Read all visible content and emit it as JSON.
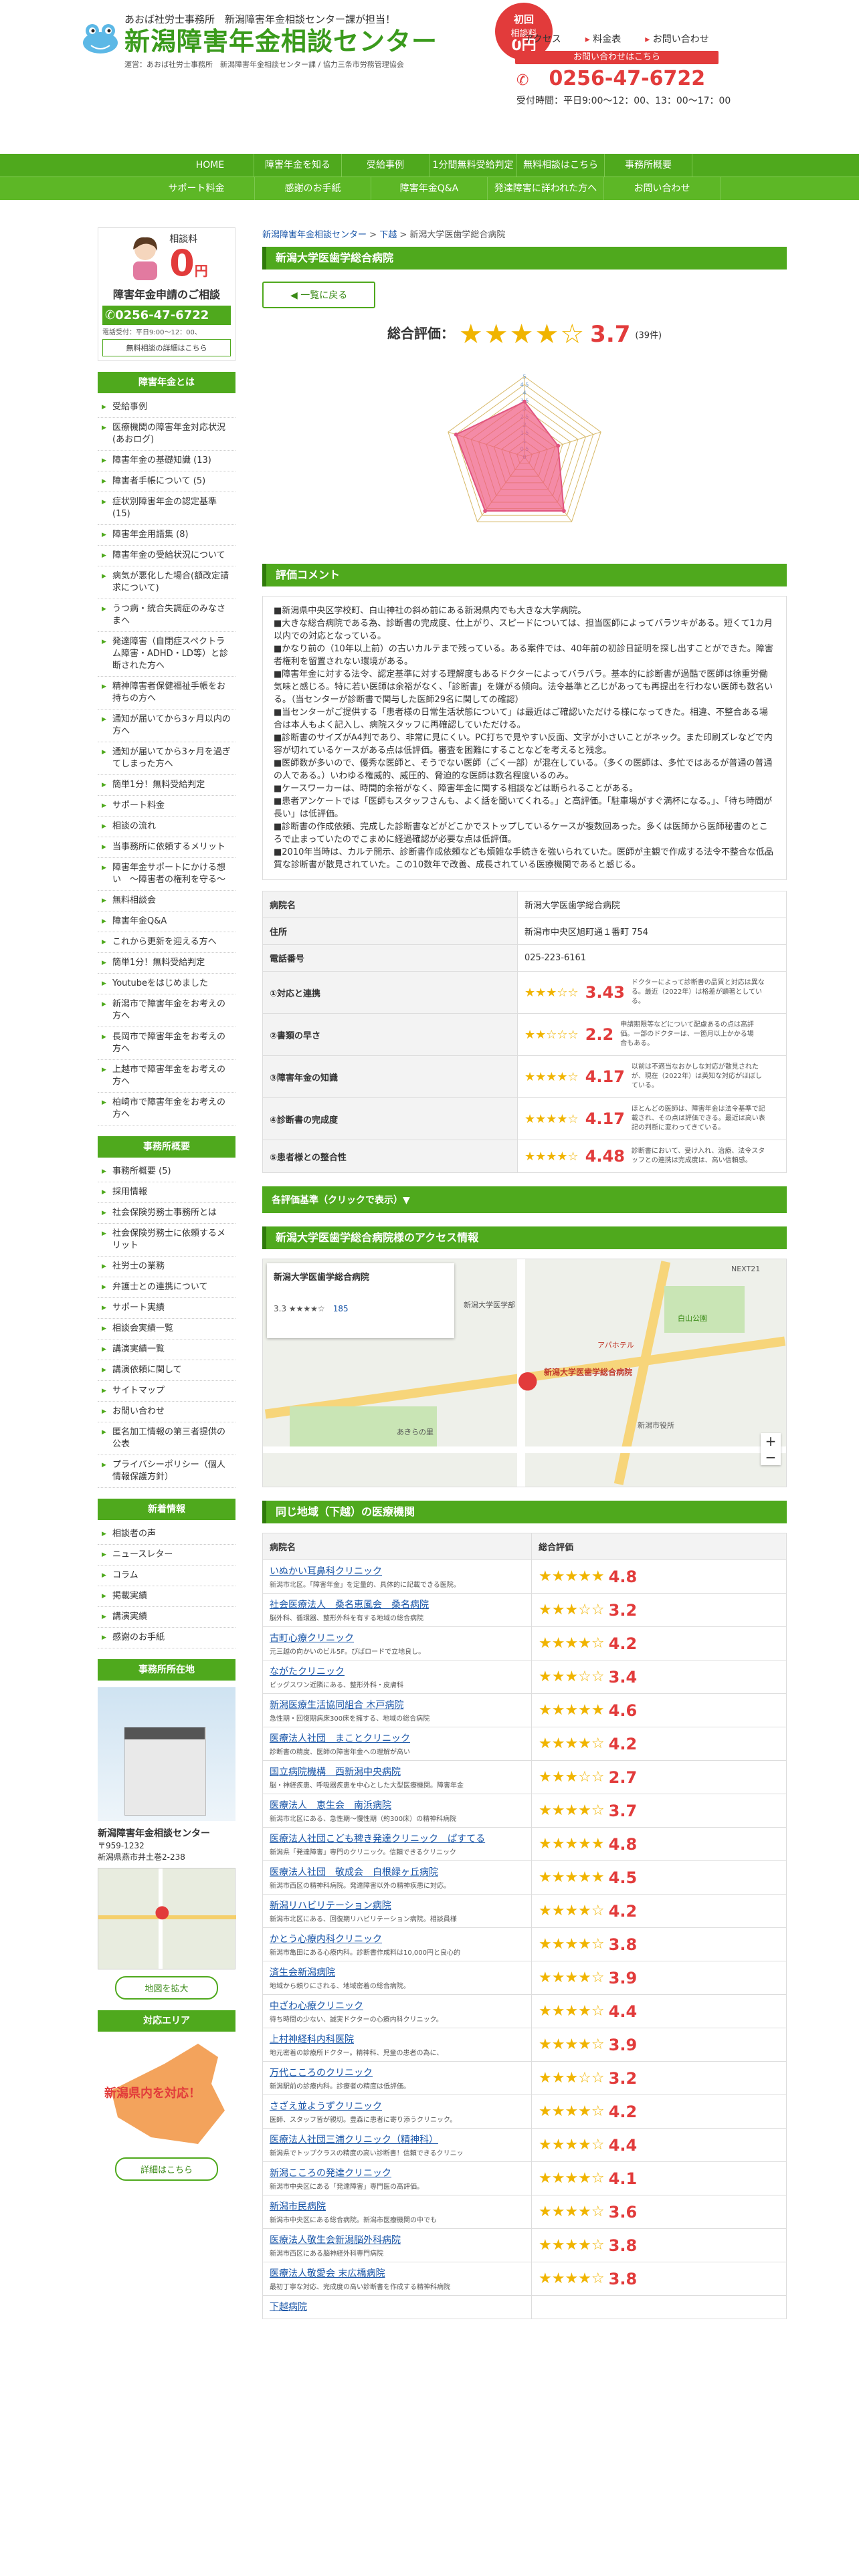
{
  "header": {
    "sub": "あおば社労士事務所　新潟障害年金相談センター課が担当！",
    "title": "新潟障害年金相談センター",
    "operator": "運営：あおば社労士事務所　新潟障害年金相談センター課 / 協力三条市労務管理協会",
    "badge_l1": "初回",
    "badge_l2": "相談料",
    "badge_l3": "0円",
    "links": [
      "アクセス",
      "料金表",
      "お問い合わせ"
    ],
    "cta": "お問い合わせはこちら",
    "phone": "0256-47-6722",
    "hours": "受付時間：平日9:00～12：00、13：00～17：00"
  },
  "nav": {
    "row1": [
      "HOME",
      "障害年金を知る",
      "受給事例",
      "1分間無料受給判定",
      "無料相談はこちら",
      "事務所概要"
    ],
    "row2": [
      "サポート料金",
      "感謝のお手紙",
      "障害年金Q&A",
      "発達障害に詳われた方へ",
      "お問い合わせ"
    ]
  },
  "breadcrumb": [
    "新潟障害年金相談センター",
    "下越",
    "新潟大学医歯学総合病院"
  ],
  "page_title": "新潟大学医歯学総合病院",
  "back_label": "一覧に戻る",
  "rating": {
    "label": "総合評価：",
    "value": "3.7",
    "count": "(39件)",
    "stars": "★★★★☆"
  },
  "chart_data": {
    "type": "radar",
    "axes": [
      "",
      "",
      "",
      "",
      ""
    ],
    "tick_labels": [
      "5",
      "4.5",
      "4",
      "3.5",
      "3",
      "2.5",
      "2",
      "1.5",
      "1",
      "0.5",
      "0"
    ],
    "values": [
      3.43,
      2.2,
      4.17,
      4.17,
      4.48
    ],
    "range": [
      0,
      5
    ]
  },
  "comment_title": "評価コメント",
  "comments": [
    "■新潟県中央区学校町、白山神社の斜め前にある新潟県内でも大きな大学病院。",
    "■大きな総合病院である為、診断書の完成度、仕上がり、スピードについては、担当医師によってバラツキがある。短くて1カ月以内での対応となっている。",
    "■かなり前の（10年以上前）の古いカルテまで残っている。ある案件では、40年前の初診日証明を探し出すことができた。障害者権利を留置されない環境がある。",
    "■障害年金に対する法令、認定基準に対する理解度もあるドクターによってバラバラ。基本的に診断書が過酷で医師は徐重労働気味と感じる。特に若い医師は余裕がなく、「診断書」を嫌がる傾向。法令基準と乙じがあっても再提出を行わない医師も数名いる。（当センターが診断書で関与した医師29名に関しての確認）",
    "■当センターがご提供する「患者様の日常生活状態について」は最近はご確認いただける様になってきた。相違、不整合ある場合は本人もよく記入し、病院スタッフに再確認していただける。",
    "■診断書のサイズがA4判であり、非常に見にくい。PC打ちで見やすい反面、文字が小さいことがネック。また印刷ズレなどで内容が切れているケースがある点は低評価。審査を困難にすることなどを考えると残念。",
    "■医師数が多いので、優秀な医師と、そうでない医師（ごく一部）が混在している。（多くの医師は、多忙ではあるが普通の普通の人である。）いわゆる権威的、威圧的、脅迫的な医師は数名程度いるのみ。",
    "■ケースワーカーは、時間的余裕がなく、障害年金に関する相談などは断られることがある。",
    "■患者アンケートでは「医師もスタッフさんも、よく話を聞いてくれる。」と高評価。「駐車場がすぐ満杯になる。」、「待ち時間が長い」は低評価。",
    "■診断書の作成依頼、完成した診断書などがどこかでストップしているケースが複数回あった。多くは医師から医師秘書のところで止まっていたのでこまめに経過確認が必要な点は低評価。",
    "■2010年当時は、カルテ開示、診断書作成依頼なども煩雑な手続きを強いられていた。医師が主観で作成する法令不整合な低品質な診断書が散見されていた。この10数年で改善、成長されている医療機関であると感じる。"
  ],
  "info": [
    {
      "k": "病院名",
      "v": "新潟大学医歯学総合病院"
    },
    {
      "k": "住所",
      "v": "新潟市中央区旭町通１番町 754"
    },
    {
      "k": "電話番号",
      "v": "025-223-6161"
    }
  ],
  "scores": [
    {
      "k": "①対応と連携",
      "v": "3.43",
      "stars": "★★★☆☆",
      "desc": "ドクターによって診断書の品質と対応は異なる。最近（2022年）は格差が顕著としている。"
    },
    {
      "k": "②書類の早さ",
      "v": "2.2",
      "stars": "★★☆☆☆",
      "desc": "申請期限等などについて配慮あるの点は高評価。一部のドクターは、一箇月以上かかる場合もある。"
    },
    {
      "k": "③障害年金の知識",
      "v": "4.17",
      "stars": "★★★★☆",
      "desc": "以前は不適当なおかしな対応が散見されたが、現在（2022年）は英知な対応がほぼしている。"
    },
    {
      "k": "④診断書の完成度",
      "v": "4.17",
      "stars": "★★★★☆",
      "desc": "ほとんどの医師は、障害年金は法令基準で記載され、その点は評価できる。最近は高い表記の判断に変わってきている。"
    },
    {
      "k": "⑤患者様との整合性",
      "v": "4.48",
      "stars": "★★★★☆",
      "desc": "診断書において、受け入れ、治療、法令スタッフとの連携は完成度は、高い信頼感。"
    }
  ],
  "criteria_label": "各評価基準（クリックで表示）▼",
  "access_title": "新潟大学医歯学総合病院様のアクセス情報",
  "map": {
    "place_label": "新潟大学医歯学総合病院",
    "labels": [
      "新潟大学医学部",
      "NEXT21",
      "白山公園",
      "新潟市役所",
      "アパホテル",
      "あきらの里"
    ],
    "rating_text": "3.3 ★★★★☆",
    "reviews": "185",
    "zoom_in": "+",
    "zoom_out": "−"
  },
  "area_title": "同じ地域（下越）の医療機関",
  "facility_headers": [
    "病院名",
    "総合評価"
  ],
  "facilities": [
    {
      "name": "いぬかい耳鼻科クリニック",
      "desc": "新潟市北区。「障害年金」を定量的、具体的に記載できる医院。",
      "v": "4.8",
      "stars": "★★★★★"
    },
    {
      "name": "社会医療法人　桑名恵風会　桑名病院",
      "desc": "脳外科、循環器、整形外科を有する地域の総合病院",
      "v": "3.2",
      "stars": "★★★☆☆"
    },
    {
      "name": "古町心療クリニック",
      "desc": "元三越の向かいのビル5F。びばロードで立地良し。",
      "v": "4.2",
      "stars": "★★★★☆"
    },
    {
      "name": "ながたクリニック",
      "desc": "ビッグスワン近隣にある、整形外科・皮膚科",
      "v": "3.4",
      "stars": "★★★☆☆"
    },
    {
      "name": "新潟医療生活協同組合 木戸病院",
      "desc": "急性期・回復期病床300床を擁する、地域の総合病院",
      "v": "4.6",
      "stars": "★★★★★"
    },
    {
      "name": "医療法人社団　まことクリニック",
      "desc": "診断書の精度、医師の障害年金への理解が高い",
      "v": "4.2",
      "stars": "★★★★☆"
    },
    {
      "name": "国立病院機構　西新潟中央病院",
      "desc": "脳・神経疾患、呼吸器疾患を中心とした大型医療機関。障害年金",
      "v": "2.7",
      "stars": "★★★☆☆"
    },
    {
      "name": "医療法人　恵生会　南浜病院",
      "desc": "新潟市北区にある、急性期〜慢性期（約300床）の精神科病院",
      "v": "3.7",
      "stars": "★★★★☆"
    },
    {
      "name": "医療法人社団こども稗き発達クリニック　ぱすてる",
      "desc": "新潟県「発達障害」専門のクリニック。信頼できるクリニック",
      "v": "4.8",
      "stars": "★★★★★"
    },
    {
      "name": "医療法人社団　敬成会　白根緑ヶ丘病院",
      "desc": "新潟市西区の精神科病院。発達障害以外の精神疾患に対応。",
      "v": "4.5",
      "stars": "★★★★★"
    },
    {
      "name": "新潟リハビリテーション病院",
      "desc": "新潟市北区にある、回復期リハビリテーション病院。相談員様",
      "v": "4.2",
      "stars": "★★★★☆"
    },
    {
      "name": "かとう心療内科クリニック",
      "desc": "新潟市亀田にある心療内科。診断書作成料は10,000円と良心的",
      "v": "3.8",
      "stars": "★★★★☆"
    },
    {
      "name": "済生会新潟病院",
      "desc": "地域から頼りにされる、地域密着の総合病院。",
      "v": "3.9",
      "stars": "★★★★☆"
    },
    {
      "name": "中ざわ心療クリニック",
      "desc": "待ち時間の少ない、誠実ドクターの心療内科クリニック。",
      "v": "4.4",
      "stars": "★★★★☆"
    },
    {
      "name": "上村神経科内科医院",
      "desc": "地元密着の診療所ドクター。精神科、児童の患者の為に、",
      "v": "3.9",
      "stars": "★★★★☆"
    },
    {
      "name": "万代こころのクリニック",
      "desc": "新潟駅前の診療内科。診療者の精度は低評価。",
      "v": "3.2",
      "stars": "★★★☆☆"
    },
    {
      "name": "さざえ並ようずクリニック",
      "desc": "医師、スタッフ皆が親切。豊森に患者に寄り添うクリニック。",
      "v": "4.2",
      "stars": "★★★★☆"
    },
    {
      "name": "医療法人社団三浦クリニック（精神科）",
      "desc": "新潟県でトップクラスの精度の高い診断書！信頼できるクリニッ",
      "v": "4.4",
      "stars": "★★★★☆"
    },
    {
      "name": "新潟こころの発達クリニック",
      "desc": "新潟市中央区にある「発達障害」専門医の高評価。",
      "v": "4.1",
      "stars": "★★★★☆"
    },
    {
      "name": "新潟市民病院",
      "desc": "新潟市中央区にある総合病院。新潟市医療機関の中でも",
      "v": "3.6",
      "stars": "★★★★☆"
    },
    {
      "name": "医療法人敬生会新潟脳外科病院",
      "desc": "新潟市西区にある脳神経外科専門病院",
      "v": "3.8",
      "stars": "★★★★☆"
    },
    {
      "name": "医療法人敬愛会 末広橋病院",
      "desc": "最初丁寧な対応、完成度の高い診断書を作成する精神科病院",
      "v": "3.8",
      "stars": "★★★★☆"
    },
    {
      "name": "下越病院",
      "desc": "",
      "v": "",
      "stars": ""
    }
  ],
  "sidebar": {
    "card_label": "相談料",
    "card_price": "0",
    "card_yen": "円",
    "card_title": "障害年金申請のご相談",
    "card_phone": "0256-47-6722",
    "card_hours": "電話受付：平日9:00～12：00、",
    "card_btn": "無料相談の詳細はこちら",
    "sec1_title": "障害年金とは",
    "sec1_items": [
      "受給事例",
      "医療機関の障害年金対応状況(あおログ)",
      "障害年金の基礎知識 (13)",
      "障害者手帳について (5)",
      "症状別障害年金の認定基準 (15)",
      "障害年金用語集 (8)",
      "障害年金の受給状況について",
      "病気が悪化した場合(額改定請求について)",
      "うつ病・統合失調症のみなさまへ",
      "発達障害（自閉症スペクトラム障害・ADHD・LD等）と診断された方へ",
      "精神障害者保健福祉手帳をお持ちの方へ",
      "通知が届いてから3ヶ月以内の方へ",
      "通知が届いてから3ヶ月を過ぎてしまった方へ",
      "簡単1分！無料受給判定",
      "サポート料金",
      "相談の流れ",
      "当事務所に依頼するメリット",
      "障害年金サポートにかける想い　〜障害者の権利を守る〜",
      "無料相談会",
      "障害年金Q&A",
      "これから更新を迎える方へ",
      "簡単1分！無料受給判定",
      "Youtubeをはじめました",
      "新潟市で障害年金をお考えの方へ",
      "長岡市で障害年金をお考えの方へ",
      "上越市で障害年金をお考えの方へ",
      "柏崎市で障害年金をお考えの方へ"
    ],
    "sec2_title": "事務所概要",
    "sec2_items": [
      "事務所概要 (5)",
      "採用情報",
      "社会保険労務士事務所とは",
      "社会保険労務士に依頼するメリット",
      "社労士の業務",
      "弁護士との連携について",
      "サポート実績",
      "相談会実績一覧",
      "講演実績一覧",
      "講演依頼に関して",
      "サイトマップ",
      "お問い合わせ",
      "匿名加工情報の第三者提供の公表",
      "プライバシーポリシー（個人情報保護方針）"
    ],
    "sec3_title": "新着情報",
    "sec3_items": [
      "相談者の声",
      "ニュースレター",
      "コラム",
      "掲載実績",
      "講演実績",
      "感謝のお手紙"
    ],
    "sec4_title": "事務所所在地",
    "office_name": "新潟障害年金相談センター",
    "office_zip": "〒959-1232",
    "office_addr": "新潟県燕市井土巻2-238",
    "map_btn": "地図を拡大",
    "sec5_title": "対応エリア",
    "area_text": "新潟県内を対応！",
    "area_btn": "詳細はこちら"
  },
  "colors": {
    "brand_green": "#4fa91d",
    "accent_red": "#e23b3b",
    "star": "#f0b400"
  }
}
